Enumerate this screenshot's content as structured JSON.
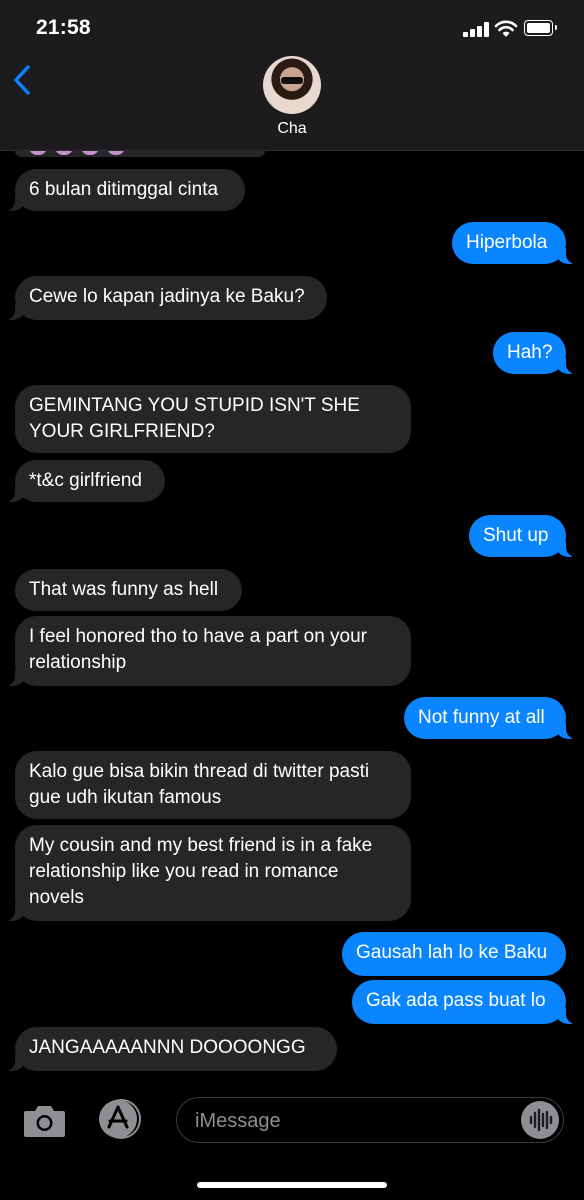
{
  "status_bar": {
    "time": "21:58"
  },
  "header": {
    "back_icon": "chevron-left-icon",
    "contact_name": "Cha"
  },
  "messages": [
    {
      "side": "in",
      "text": "6 bulan ditimggal cinta"
    },
    {
      "side": "out",
      "text": "Hiperbola"
    },
    {
      "side": "in",
      "text": "Cewe lo kapan jadinya ke Baku?"
    },
    {
      "side": "out",
      "text": "Hah?"
    },
    {
      "side": "in",
      "text": "GEMINTANG YOU STUPID ISN'T SHE YOUR GIRLFRIEND?"
    },
    {
      "side": "in",
      "text": "*t&c girlfriend"
    },
    {
      "side": "out",
      "text": "Shut up"
    },
    {
      "side": "in",
      "text": "That was funny as hell"
    },
    {
      "side": "in",
      "text": "I feel honored tho to have a part on your relationship"
    },
    {
      "side": "out",
      "text": "Not funny at all"
    },
    {
      "side": "in",
      "text": "Kalo gue bisa bikin thread di twitter pasti gue udh ikutan famous"
    },
    {
      "side": "in",
      "text": "My cousin and my best friend is in a fake relationship like you read in romance novels"
    },
    {
      "side": "out",
      "text": "Gausah lah lo ke Baku"
    },
    {
      "side": "out",
      "text": "Gak ada pass buat lo"
    },
    {
      "side": "in",
      "text": "JANGAAAAANNN DOOOONGG"
    }
  ],
  "input_bar": {
    "placeholder": "iMessage",
    "camera_icon": "camera-icon",
    "apps_icon": "app-store-icon",
    "voice_icon": "waveform-icon"
  },
  "colors": {
    "outgoing": "#0a84ff",
    "incoming": "#262628",
    "background": "#000000"
  }
}
